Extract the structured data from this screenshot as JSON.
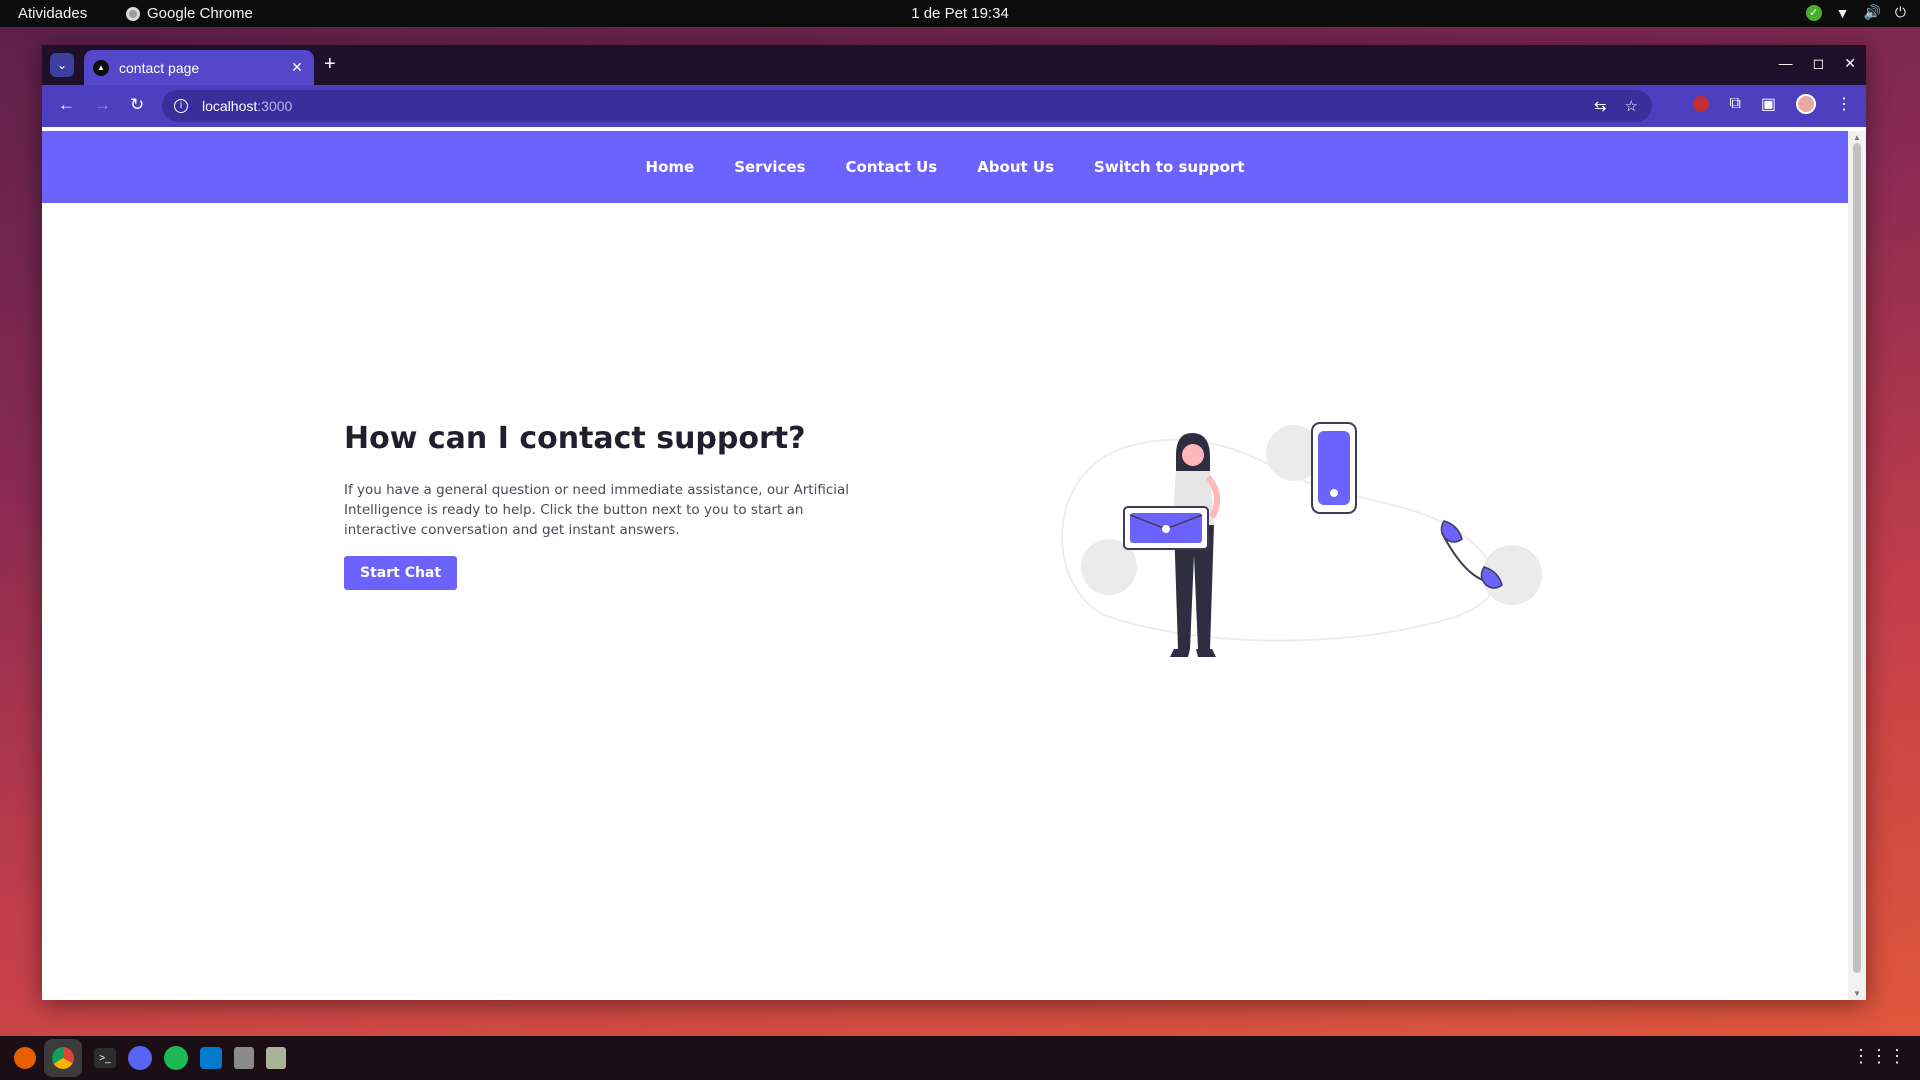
{
  "topbar": {
    "activities": "Atividades",
    "app_name": "Google Chrome",
    "clock": "1 de Pet  19:34"
  },
  "browser": {
    "tab_title": "contact page",
    "url_host": "localhost",
    "url_port": ":3000"
  },
  "site": {
    "nav": [
      "Home",
      "Services",
      "Contact Us",
      "About Us",
      "Switch to support"
    ],
    "heading": "How can I contact support?",
    "description": "If you have a general question or need immediate assistance, our Artificial Intelligence is ready to help. Click the button next to you to start an interactive conversation and get instant answers.",
    "cta_label": "Start Chat"
  },
  "colors": {
    "accent": "#6c63ff",
    "tab_strip": "#1f0f2b",
    "toolbar": "#4c40c0",
    "dock": "#1b0e14"
  },
  "icons": {
    "tray": [
      "check-circle-icon",
      "wifi-icon",
      "volume-icon",
      "power-icon"
    ],
    "dock": [
      "firefox-icon",
      "chrome-icon",
      "terminal-icon",
      "discord-icon",
      "spotify-icon",
      "vscode-icon",
      "disk-icon",
      "trash-icon",
      "apps-grid-icon"
    ]
  }
}
